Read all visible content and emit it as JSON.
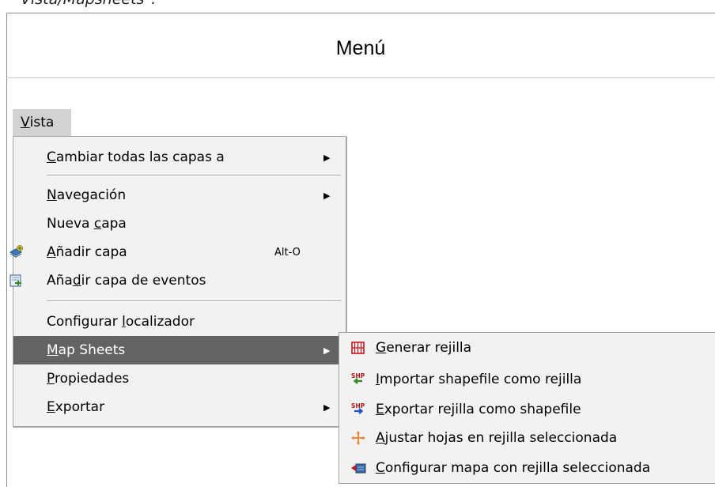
{
  "caption": "Vista/Mapsheets\".",
  "panel_title": "Menú",
  "menubar": {
    "vista": {
      "mnemonic": "V",
      "rest": "ista"
    }
  },
  "menu": {
    "items": [
      {
        "pre": "",
        "mn": "C",
        "post": "ambiar todas las capas a",
        "submenu": true
      },
      {
        "pre": "",
        "mn": "N",
        "post": "avegación",
        "submenu": true
      },
      {
        "pre": "Nueva ",
        "mn": "c",
        "post": "apa"
      },
      {
        "pre": "",
        "mn": "A",
        "post": "ñadir capa",
        "shortcut": "Alt-O",
        "icon": "add-layer-icon"
      },
      {
        "pre": "Aña",
        "mn": "d",
        "post": "ir capa de eventos",
        "icon": "add-event-layer-icon"
      },
      {
        "pre": "Configurar ",
        "mn": "l",
        "post": "ocalizador"
      },
      {
        "pre": "",
        "mn": "M",
        "post": "ap Sheets",
        "submenu": true,
        "selected": true
      },
      {
        "pre": "",
        "mn": "P",
        "post": "ropiedades"
      },
      {
        "pre": "",
        "mn": "E",
        "post": "xportar",
        "submenu": true
      }
    ]
  },
  "submenu": {
    "items": [
      {
        "pre": "",
        "mn": "G",
        "post": "enerar rejilla",
        "icon": "grid-icon"
      },
      {
        "pre": "",
        "mn": "I",
        "post": "mportar shapefile como rejilla",
        "icon": "import-shp-icon"
      },
      {
        "pre": "",
        "mn": "E",
        "post": "xportar rejilla como shapefile",
        "icon": "export-shp-icon"
      },
      {
        "pre": "",
        "mn": "A",
        "post": "justar hojas en rejilla seleccionada",
        "icon": "adjust-sheets-icon"
      },
      {
        "pre": "",
        "mn": "C",
        "post": "onfigurar mapa con rejilla seleccionada",
        "icon": "configure-map-icon"
      }
    ]
  },
  "colors": {
    "selected_bg": "#636363",
    "menu_bg": "#f2f2f2",
    "menubar_active": "#d2d2d2"
  }
}
